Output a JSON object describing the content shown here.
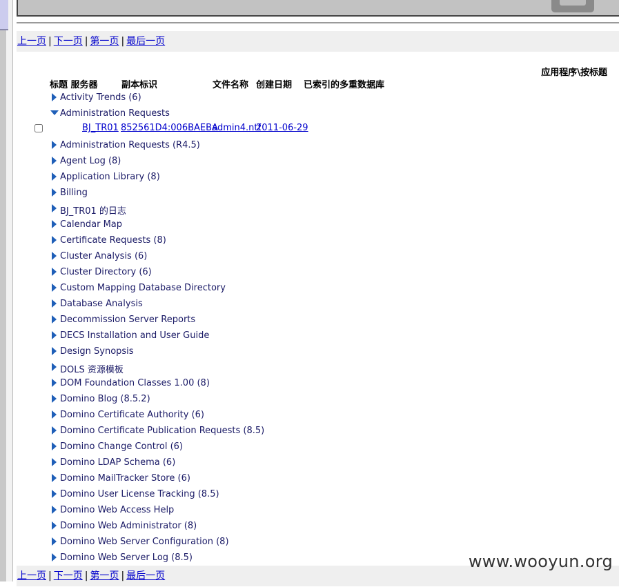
{
  "pager": {
    "prev": "上一页",
    "next": "下一页",
    "first": "第一页",
    "last": "最后一页",
    "separator": "|"
  },
  "view_title": "应用程序\\按标题",
  "columns": {
    "title_server": "标题 服务器",
    "replica_id": "副本标识",
    "file_name": "文件名称",
    "created": "创建日期",
    "indexed": "已索引的多重数据库"
  },
  "categories": [
    "Activity Trends (6)",
    "Administration Requests",
    "Administration Requests (R4.5)",
    "Agent Log (8)",
    "Application Library (8)",
    "Billing",
    "BJ_TR01 的日志",
    "Calendar Map",
    "Certificate Requests (8)",
    "Cluster Analysis (6)",
    "Cluster Directory (6)",
    "Custom Mapping Database Directory",
    "Database Analysis",
    "Decommission Server Reports",
    "DECS Installation and User Guide",
    "Design Synopsis",
    "DOLS 资源模板",
    "DOM Foundation Classes 1.00 (8)",
    "Domino Blog (8.5.2)",
    "Domino Certificate Authority (6)",
    "Domino Certificate Publication Requests (8.5)",
    "Domino Change Control (6)",
    "Domino LDAP Schema (6)",
    "Domino MailTracker Store (6)",
    "Domino User License Tracking (8.5)",
    "Domino Web Access Help",
    "Domino Web Administrator (8)",
    "Domino Web Server Configuration (8)",
    "Domino Web Server Log (8.5)"
  ],
  "expanded_document": {
    "server": "BJ_TR01",
    "replica_id": "852561D4:006BAEBA",
    "file_name": "admin4.ntf",
    "created": "2011-06-29"
  },
  "watermark": "www.wooyun.org",
  "colors": {
    "link": "#0000cc",
    "category_text": "#1a1a66",
    "twisty": "#1f5fb8",
    "pager_bg": "#efefef"
  }
}
